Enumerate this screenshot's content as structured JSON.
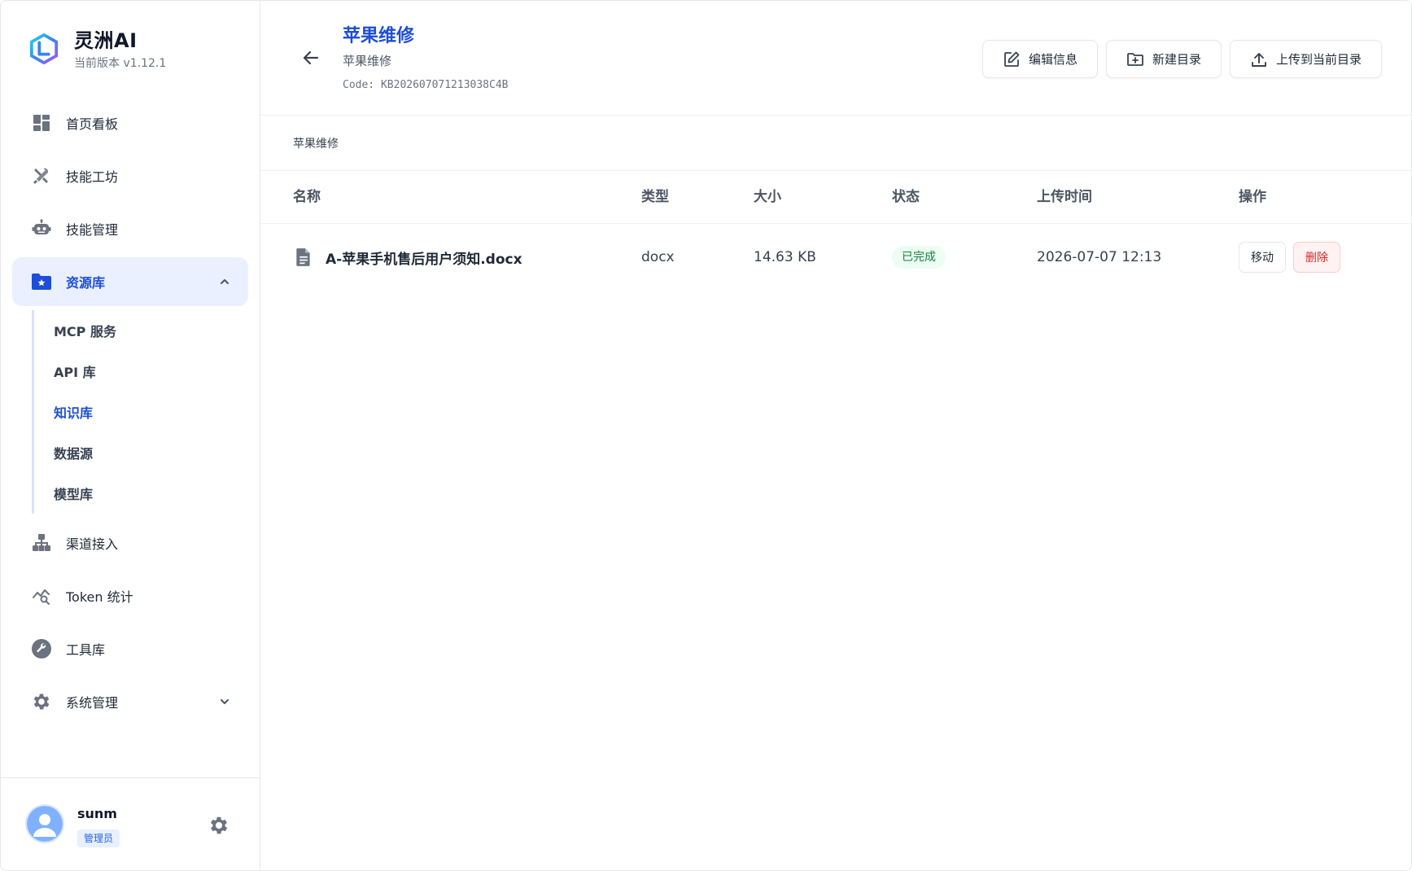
{
  "brand": {
    "name": "灵洲AI",
    "version": "当前版本 v1.12.1"
  },
  "nav": {
    "items": [
      {
        "label": "首页看板",
        "icon": "dashboard-icon"
      },
      {
        "label": "技能工坊",
        "icon": "tools-icon"
      },
      {
        "label": "技能管理",
        "icon": "robot-icon"
      },
      {
        "label": "资源库",
        "icon": "folder-star-icon",
        "active": true,
        "expanded": true
      },
      {
        "label": "渠道接入",
        "icon": "sitemap-icon"
      },
      {
        "label": "Token 统计",
        "icon": "chart-search-icon"
      },
      {
        "label": "工具库",
        "icon": "wrench-icon"
      },
      {
        "label": "系统管理",
        "icon": "gear-icon",
        "expanded": false
      }
    ],
    "resource_sub": [
      {
        "label": "MCP 服务"
      },
      {
        "label": "API 库"
      },
      {
        "label": "知识库",
        "active": true
      },
      {
        "label": "数据源"
      },
      {
        "label": "模型库"
      }
    ]
  },
  "user": {
    "name": "sunm",
    "role": "管理员"
  },
  "header": {
    "title": "苹果维修",
    "subtitle": "苹果维修",
    "code": "Code: KB202607071213038C4B",
    "buttons": {
      "edit": "编辑信息",
      "new_dir": "新建目录",
      "upload": "上传到当前目录"
    }
  },
  "breadcrumb": {
    "current": "苹果维修"
  },
  "table": {
    "headers": {
      "name": "名称",
      "type": "类型",
      "size": "大小",
      "status": "状态",
      "time": "上传时间",
      "ops": "操作"
    },
    "rows": [
      {
        "name": "A-苹果手机售后用户须知.docx",
        "type": "docx",
        "size": "14.63 KB",
        "status": "已完成",
        "time": "2026-07-07 12:13",
        "actions": {
          "move": "移动",
          "delete": "删除"
        }
      }
    ]
  },
  "colors": {
    "accent": "#1d4ed8",
    "active_bg": "#eaf0ff",
    "success_bg": "#ecfdf3",
    "success_text": "#15803d",
    "danger_bg": "#fef2f2",
    "danger_text": "#dc2626"
  }
}
